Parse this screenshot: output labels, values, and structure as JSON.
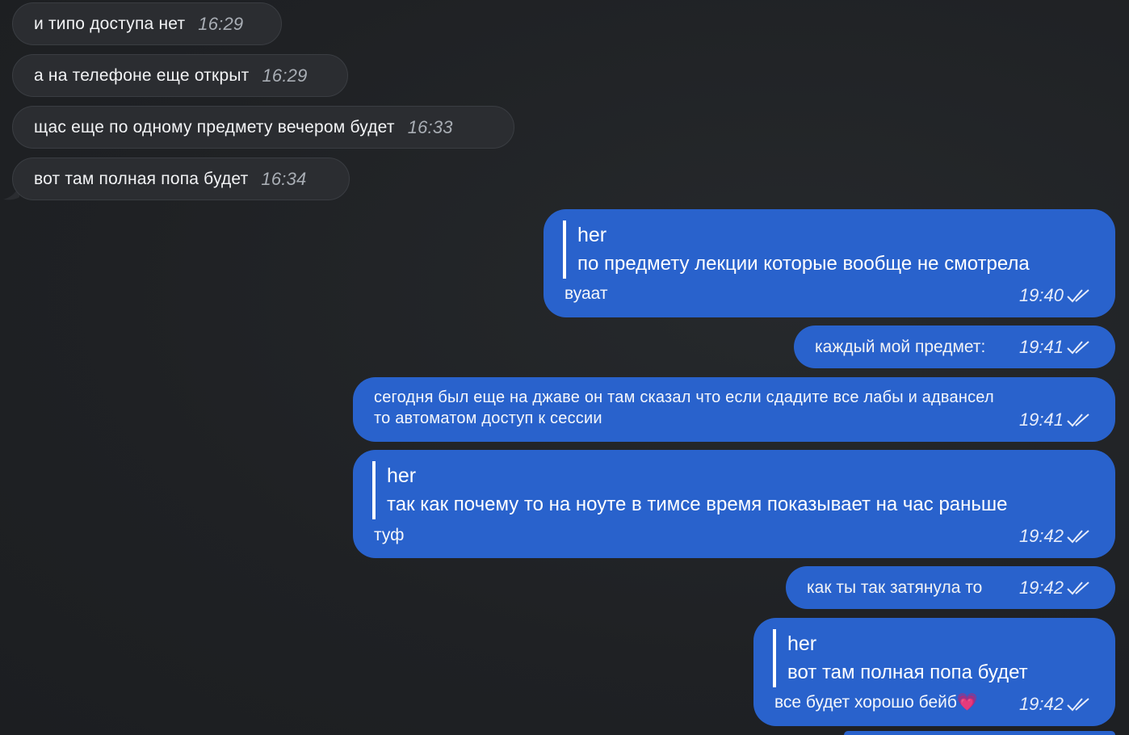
{
  "incoming": [
    {
      "text": "и типо доступа нет",
      "time": "16:29"
    },
    {
      "text": "а на телефоне еще открыт",
      "time": "16:29"
    },
    {
      "text": "щас еще по одному предмету вечером будет",
      "time": "16:33"
    },
    {
      "text": "вот там полная попа будет",
      "time": "16:34"
    }
  ],
  "outgoing": [
    {
      "quote_author": "her",
      "quote_text": "по предмету лекции которые вообще не смотрела",
      "text": "вуаат",
      "time": "19:40"
    },
    {
      "text": "каждый мой предмет:",
      "time": "19:41"
    },
    {
      "lines": [
        "сегодня был еще на джаве он там сказал что если сдадите все лабы и адвансел",
        "то автоматом доступ к сессии"
      ],
      "time": "19:41"
    },
    {
      "quote_author": "her",
      "quote_text": "так как почему то на ноуте в тимсе время показывает на час раньше",
      "text": "туф",
      "time": "19:42"
    },
    {
      "text": "как ты так затянула то",
      "time": "19:42"
    },
    {
      "quote_author": "her",
      "quote_text": "вот там полная попа будет",
      "text": "все будет хорошо бейб💗",
      "time": "19:42"
    }
  ],
  "colors": {
    "background": "#1f2124",
    "incoming_bubble": "#2b2d31",
    "outgoing_bubble": "#2962cc"
  },
  "icons": {
    "read_receipt": "double-check-icon"
  }
}
